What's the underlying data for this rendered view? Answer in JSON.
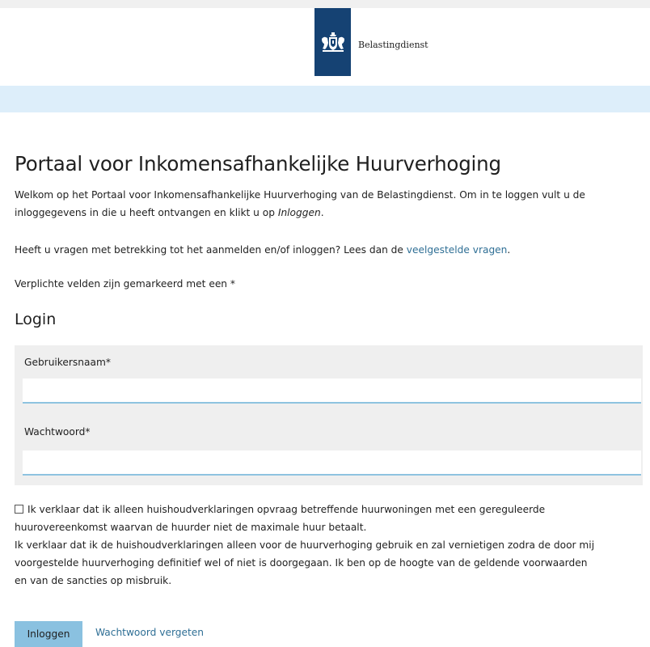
{
  "header": {
    "logo_text": "Belastingdienst"
  },
  "main": {
    "title": "Portaal voor Inkomensafhankelijke Huurverhoging",
    "intro_line1": "Welkom op het Portaal voor Inkomensafhankelijke Huurverhoging van de Belastingdienst. Om in te loggen vult u de",
    "intro_line2_prefix": "inloggegevens in die u heeft ontvangen en klikt u op ",
    "intro_line2_em": "Inloggen",
    "intro_line2_suffix": ".",
    "questions_prefix": "Heeft u vragen met betrekking tot het aanmelden en/of inloggen? Lees dan de ",
    "questions_link": "veelgestelde vragen",
    "questions_suffix": ".",
    "required_note": "Verplichte velden zijn gemarkeerd met een *"
  },
  "login": {
    "heading": "Login",
    "username_label": "Gebruikersnaam*",
    "username_value": "",
    "password_label": "Wachtwoord*",
    "password_value": ""
  },
  "declaration": {
    "line1": "Ik verklaar dat ik alleen huishoudverklaringen opvraag betreffende huurwoningen met een gereguleerde",
    "line2": "huurovereenkomst waarvan de huurder niet de maximale huur betaalt.",
    "line3": "Ik verklaar dat ik de huishoudverklaringen alleen voor de huurverhoging gebruik en zal vernietigen zodra de door mij",
    "line4": "voorgestelde huurverhoging definitief wel of niet is doorgegaan. Ik ben op de hoogte van de geldende voorwaarden",
    "line5": "en van de sancties op misbruik."
  },
  "actions": {
    "login_button": "Inloggen",
    "forgot_password": "Wachtwoord vergeten"
  }
}
